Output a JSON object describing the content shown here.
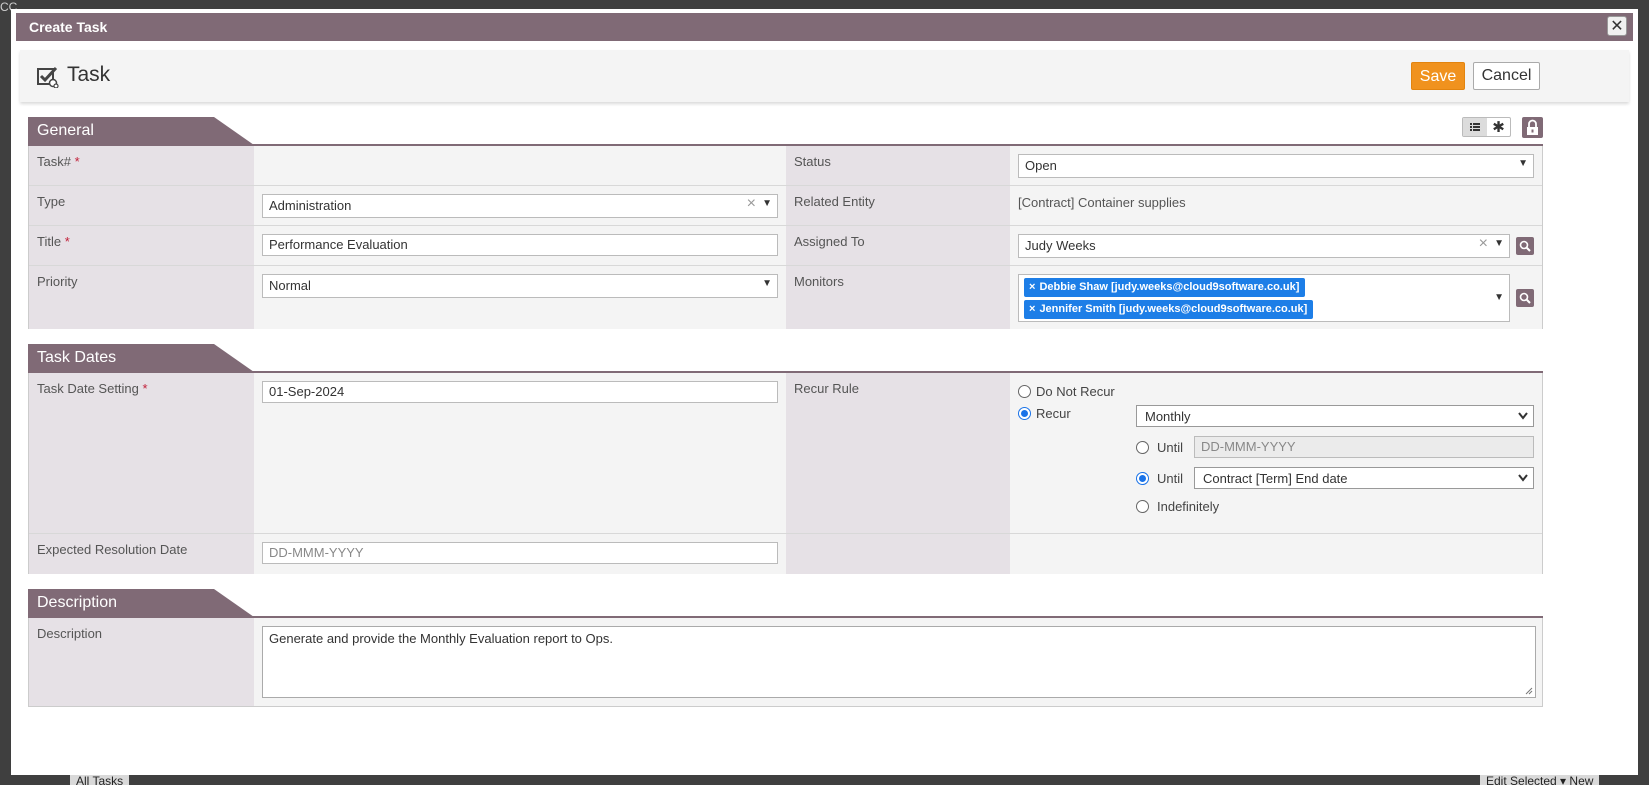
{
  "background": {
    "logo_text": "CC",
    "bottom_left": "All Tasks",
    "bottom_right": "Edit Selected  ▾  New"
  },
  "dialog": {
    "title": "Create Task",
    "close_symbol": "✕"
  },
  "toolbar": {
    "title": "Task",
    "icon": "task-checkbox-icon",
    "save_label": "Save",
    "cancel_label": "Cancel"
  },
  "colors": {
    "header": "#806a76",
    "save": "#f0921e",
    "tag": "#1d7ee7",
    "required": "#c21f39"
  },
  "general": {
    "heading": "General",
    "task_no_label": "Task#",
    "required_mark": "*",
    "status_label": "Status",
    "status_value": "Open",
    "type_label": "Type",
    "type_value": "Administration",
    "related_entity_label": "Related Entity",
    "related_entity_value": "[Contract] Container supplies",
    "title_label": "Title",
    "title_value": "Performance Evaluation",
    "assigned_to_label": "Assigned To",
    "assigned_to_value": "Judy Weeks",
    "priority_label": "Priority",
    "priority_value": "Normal",
    "monitors_label": "Monitors",
    "monitors": [
      "Debbie Shaw [judy.weeks@cloud9software.co.uk]",
      "Jennifer Smith [judy.weeks@cloud9software.co.uk]"
    ]
  },
  "task_dates": {
    "heading": "Task Dates",
    "date_setting_label": "Task Date Setting",
    "date_setting_value": "01-Sep-2024",
    "recur_rule_label": "Recur Rule",
    "do_not_recur_label": "Do Not Recur",
    "recur_label": "Recur",
    "recur_frequency": "Monthly",
    "until_label": "Until",
    "until_date_placeholder": "DD-MMM-YYYY",
    "until_contract_value": "Contract [Term] End date",
    "indefinitely_label": "Indefinitely",
    "selected_recur": "Recur",
    "selected_until": "contract",
    "expected_resolution_label": "Expected Resolution Date",
    "expected_resolution_placeholder": "DD-MMM-YYYY"
  },
  "description": {
    "heading": "Description",
    "label": "Description",
    "value": "Generate and provide the Monthly Evaluation report to Ops."
  }
}
